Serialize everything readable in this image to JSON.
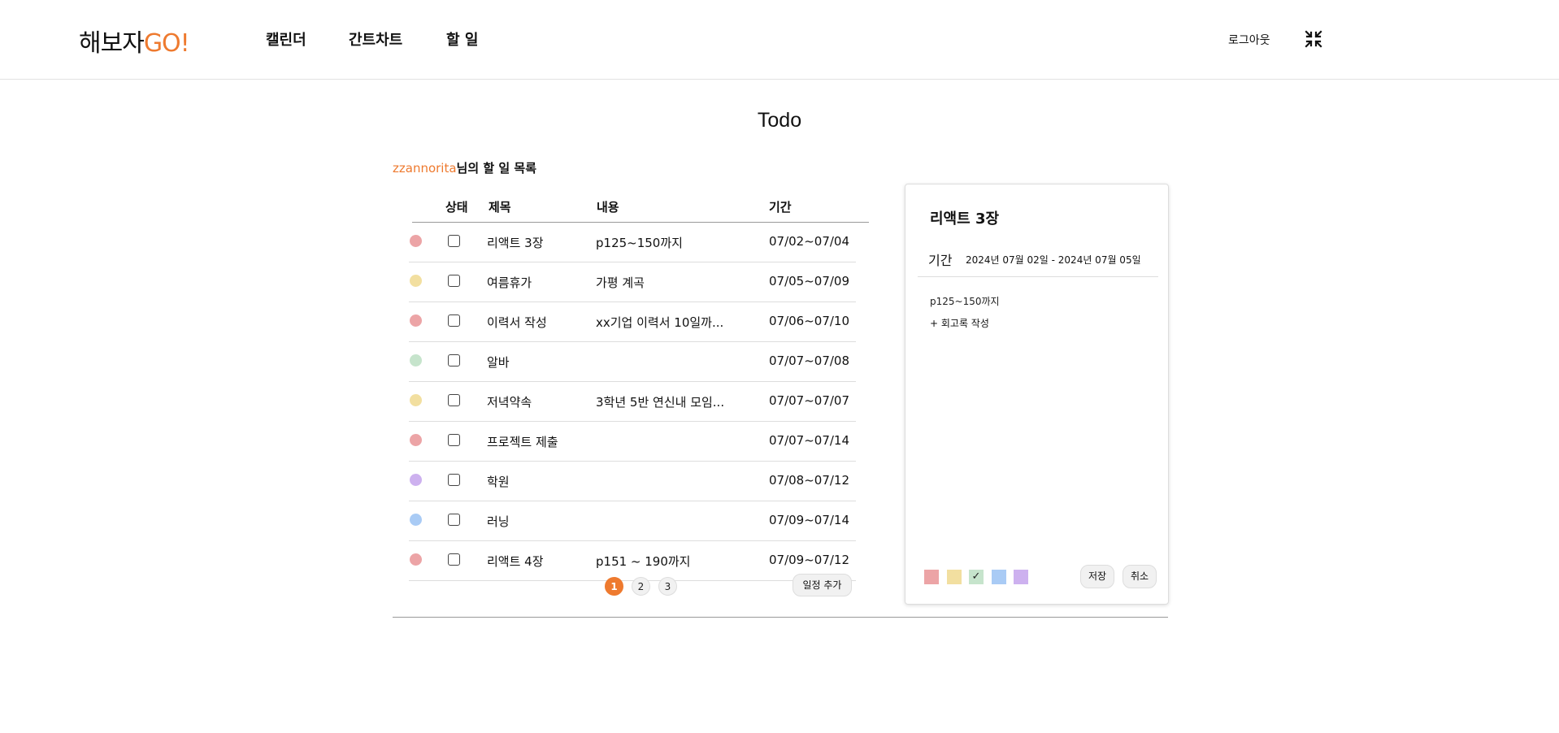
{
  "header": {
    "logo_prefix": "해보자",
    "logo_go": "GO!",
    "nav": [
      "캘린더",
      "간트차트",
      "할 일"
    ],
    "logout": "로그아웃",
    "collapse_icon": "collapse-arrows-icon"
  },
  "page": {
    "title": "Todo",
    "username": "zzannorita",
    "owner_suffix": "님의 할 일 목록"
  },
  "table": {
    "headers": [
      "상태",
      "제목",
      "내용",
      "기간"
    ],
    "rows": [
      {
        "color": "#eca4a6",
        "title": "리액트 3장",
        "content": "p125~150까지",
        "date": "07/02~07/04"
      },
      {
        "color": "#f2dfa0",
        "title": "여름휴가",
        "content": "가평 계곡",
        "date": "07/05~07/09"
      },
      {
        "color": "#eca4a6",
        "title": "이력서 작성",
        "content": "xx기업 이력서 10일까...",
        "date": "07/06~07/10"
      },
      {
        "color": "#c6e4cc",
        "title": "알바",
        "content": "",
        "date": "07/07~07/08"
      },
      {
        "color": "#f2dfa0",
        "title": "저녁약속",
        "content": "3학년 5반 연신내 모임...",
        "date": "07/07~07/07"
      },
      {
        "color": "#eca4a6",
        "title": "프로젝트 제출",
        "content": "",
        "date": "07/07~07/14"
      },
      {
        "color": "#cdb1ef",
        "title": "학원",
        "content": "",
        "date": "07/08~07/12"
      },
      {
        "color": "#a9cbf5",
        "title": "러닝",
        "content": "",
        "date": "07/09~07/14"
      },
      {
        "color": "#eca4a6",
        "title": "리액트 4장",
        "content": "p151 ~ 190까지",
        "date": "07/09~07/12"
      }
    ]
  },
  "pagination": {
    "pages": [
      "1",
      "2",
      "3"
    ],
    "active": "1"
  },
  "add_button": "일정 추가",
  "detail": {
    "title": "리액트 3장",
    "period_label": "기간",
    "period_value": "2024년 07월 02일 - 2024년 07월 05일",
    "content": "p125~150까지",
    "review_link": "+ 회고록 작성",
    "colors": [
      "#eca4a6",
      "#f2dfa0",
      "#c6e4cc",
      "#a9cbf5",
      "#cdb1ef"
    ],
    "selected_color_mark": "✓",
    "save": "저장",
    "cancel": "취소"
  },
  "accent_color": "#ee7a2f"
}
